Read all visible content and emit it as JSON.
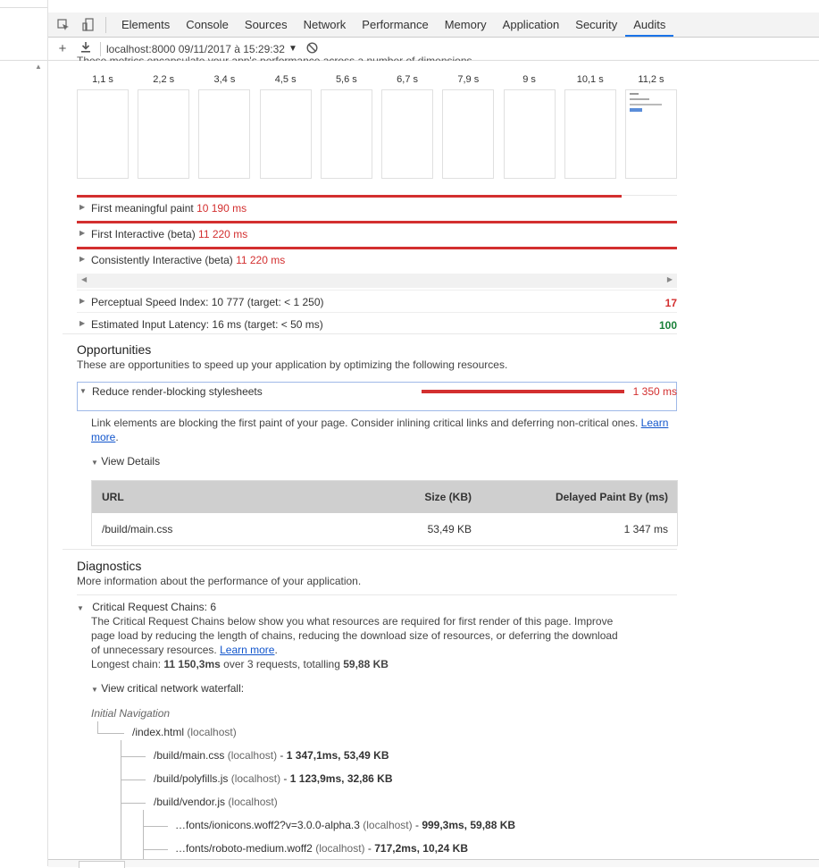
{
  "toolbar": {
    "tabs": [
      "Elements",
      "Console",
      "Sources",
      "Network",
      "Performance",
      "Memory",
      "Application",
      "Security",
      "Audits"
    ],
    "active_tab": "Audits"
  },
  "subbar": {
    "report": "localhost:8000 09/11/2017 à 15:29:32"
  },
  "cut_text": "These metrics encapsulate your app's performance across a number of dimensions.",
  "frames": [
    "1,1 s",
    "2,2 s",
    "3,4 s",
    "4,5 s",
    "5,6 s",
    "6,7 s",
    "7,9 s",
    "9 s",
    "10,1 s",
    "11,2 s"
  ],
  "metrics": {
    "fmp": {
      "label": "First meaningful paint",
      "value": "10 190 ms"
    },
    "fi": {
      "label": "First Interactive (beta)",
      "value": "11 220 ms"
    },
    "ci": {
      "label": "Consistently Interactive (beta)",
      "value": "11 220 ms"
    },
    "psi": {
      "label": "Perceptual Speed Index: 10 777 (target: < 1 250)",
      "score": "17"
    },
    "eil": {
      "label": "Estimated Input Latency: 16 ms (target: < 50 ms)",
      "score": "100"
    }
  },
  "opportunities": {
    "title": "Opportunities",
    "desc": "These are opportunities to speed up your application by optimizing the following resources.",
    "item": {
      "label": "Reduce render-blocking stylesheets",
      "value": "1 350 ms"
    },
    "para1": "Link elements are blocking the first paint of your page. Consider inlining critical links and deferring non-critical ones.",
    "para_link1": "Learn",
    "para_link2": "more",
    "view_details": "View Details",
    "table": {
      "headers": [
        "URL",
        "Size (KB)",
        "Delayed Paint By (ms)"
      ],
      "rows": [
        [
          "/build/main.css",
          "53,49 KB",
          "1 347 ms"
        ]
      ]
    }
  },
  "diagnostics": {
    "title": "Diagnostics",
    "desc": "More information about the performance of your application.",
    "crc_label": "Critical Request Chains: 6",
    "crc_l1": "The Critical Request Chains below show you what resources are required for first render of this page. Improve",
    "crc_l2": "page load by reducing the length of chains, reducing the download size of resources, or deferring the download",
    "crc_l3": "of unnecessary resources.",
    "learn_more": "Learn more",
    "longest_prefix": "Longest chain:",
    "longest_bold1": "11 150,3ms",
    "longest_mid": "over 3 requests, totalling",
    "longest_bold2": "59,88 KB",
    "waterfall": "View critical network waterfall:",
    "nav": "Initial Navigation",
    "n0": {
      "path": "/index.html",
      "host": "(localhost)"
    },
    "n1": {
      "path": "/build/main.css",
      "host": "(localhost)",
      "sep": "-",
      "stats": "1 347,1ms, 53,49 KB"
    },
    "n2": {
      "path": "/build/polyfills.js",
      "host": "(localhost)",
      "sep": "-",
      "stats": "1 123,9ms, 32,86 KB"
    },
    "n3": {
      "path": "/build/vendor.js",
      "host": "(localhost)"
    },
    "n4": {
      "path": "…fonts/ionicons.woff2?v=3.0.0-alpha.3",
      "host": "(localhost)",
      "sep": "-",
      "stats": "999,3ms, 59,88 KB"
    },
    "n5": {
      "path": "…fonts/roboto-medium.woff2",
      "host": "(localhost)",
      "sep": "-",
      "stats": "717,2ms, 10,24 KB"
    }
  },
  "colors": {
    "red": "#d32f2f",
    "green": "#188038",
    "accent": "#1a73e8"
  }
}
